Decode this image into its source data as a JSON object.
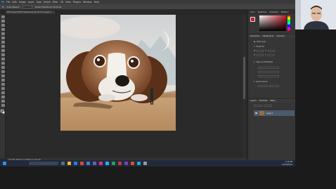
{
  "app": {
    "menu": [
      "File",
      "Edit",
      "Image",
      "Layer",
      "Type",
      "Select",
      "Filter",
      "3D",
      "View",
      "Plugins",
      "Window",
      "Help"
    ],
    "options": [
      "Auto-Select:",
      "Layer",
      "Show Transform Controls"
    ],
    "doc_tab": "EVO Project EDIT Cavalier.psd @ 33.3% (Layer 1, RGB/8#) *",
    "status": "33.33%    2520 px x 2520 px (72 ppi)"
  },
  "panels": {
    "top_tabs": [
      "Color",
      "Swatches",
      "Gradients",
      "Patterns"
    ],
    "properties_tabs": [
      "Properties",
      "Adjustments",
      "Libraries"
    ],
    "properties_title": "Pixel Layer",
    "transform_label": "Transform",
    "align_label": "Align and Distribute",
    "quick_actions_label": "Quick Actions",
    "rows": [
      {
        "label": "W",
        "value": ""
      },
      {
        "label": "H",
        "value": ""
      },
      {
        "label": "X",
        "value": ""
      },
      {
        "label": "Y",
        "value": ""
      }
    ],
    "layers_tabs": [
      "Layers",
      "Channels",
      "Paths"
    ],
    "layer_name": "Layer 1",
    "accent_color": "#c41e2d"
  },
  "taskbar": {
    "search_placeholder": "",
    "time": "1:34 PM",
    "date": "10/20/2023"
  }
}
